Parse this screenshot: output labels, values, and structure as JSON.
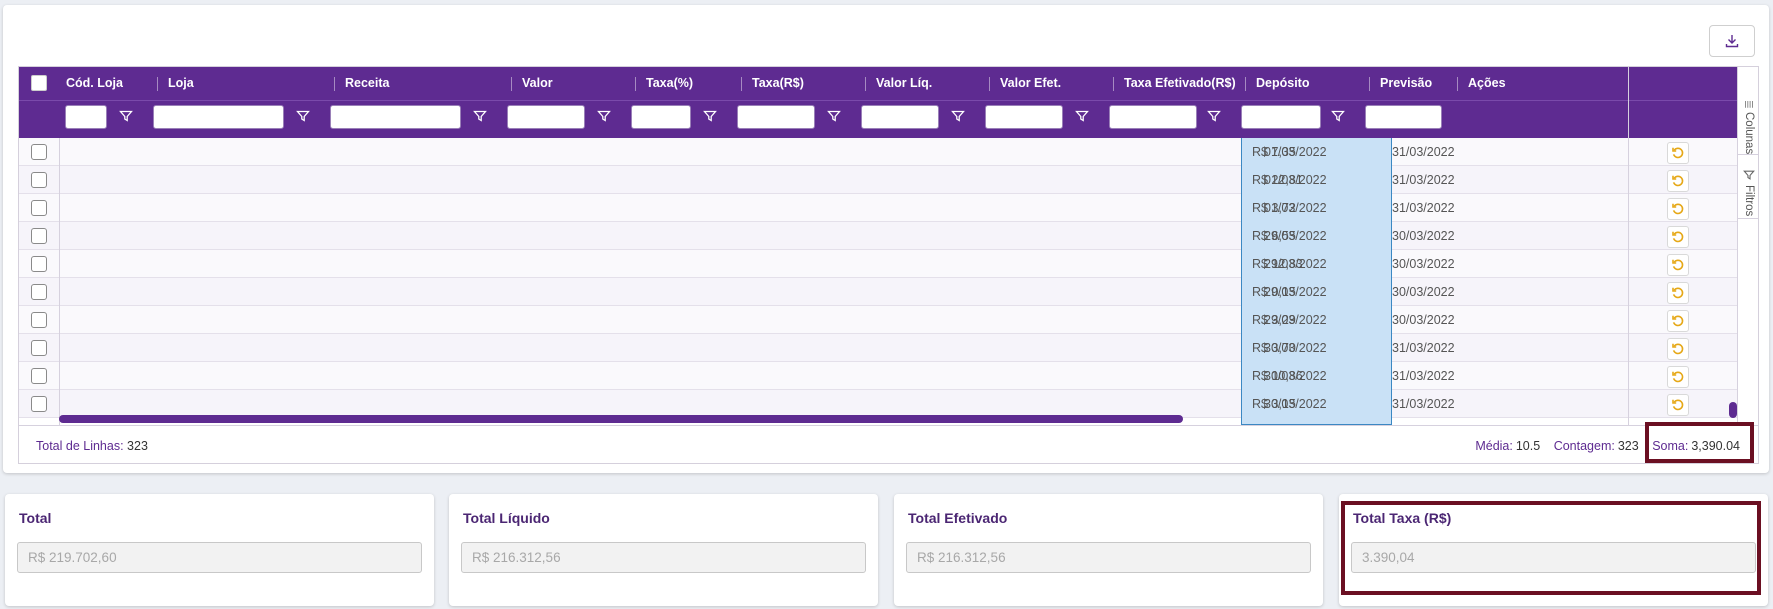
{
  "toolbar": {
    "export_icon": "download-icon"
  },
  "grid": {
    "columns": [
      {
        "key": "cod_loja",
        "label": "Cód. Loja"
      },
      {
        "key": "loja",
        "label": "Loja"
      },
      {
        "key": "receita",
        "label": "Receita"
      },
      {
        "key": "valor",
        "label": "Valor"
      },
      {
        "key": "taxa_pct",
        "label": "Taxa(%)"
      },
      {
        "key": "taxa_rs",
        "label": "Taxa(R$)"
      },
      {
        "key": "valor_liq",
        "label": "Valor Líq."
      },
      {
        "key": "valor_efet",
        "label": "Valor Efet."
      },
      {
        "key": "taxa_efetivado",
        "label": "Taxa Efetivado(R$)"
      },
      {
        "key": "deposito",
        "label": "Depósito"
      },
      {
        "key": "previsao",
        "label": "Previsão"
      },
      {
        "key": "acoes",
        "label": "Ações"
      }
    ],
    "rows": [
      {
        "taxa_efetivado": "R$ 7,35",
        "deposito": "01/03/2022",
        "previsao": "31/03/2022"
      },
      {
        "taxa_efetivado": "R$ 22,81",
        "deposito": "01/03/2022",
        "previsao": "31/03/2022"
      },
      {
        "taxa_efetivado": "R$ 3,72",
        "deposito": "01/03/2022",
        "previsao": "31/03/2022"
      },
      {
        "taxa_efetivado": "R$ 6,55",
        "deposito": "29/03/2022",
        "previsao": "30/03/2022"
      },
      {
        "taxa_efetivado": "R$ 12,83",
        "deposito": "29/03/2022",
        "previsao": "30/03/2022"
      },
      {
        "taxa_efetivado": "R$ 0,15",
        "deposito": "29/03/2022",
        "previsao": "30/03/2022"
      },
      {
        "taxa_efetivado": "R$ 3,29",
        "deposito": "29/03/2022",
        "previsao": "30/03/2022"
      },
      {
        "taxa_efetivado": "R$ 3,70",
        "deposito": "30/03/2022",
        "previsao": "31/03/2022"
      },
      {
        "taxa_efetivado": "R$ 10,86",
        "deposito": "30/03/2022",
        "previsao": "31/03/2022"
      },
      {
        "taxa_efetivado": "R$ 3,15",
        "deposito": "30/03/2022",
        "previsao": "31/03/2022"
      }
    ],
    "side_panel": {
      "columns_label": "Colunas",
      "filters_label": "Filtros"
    },
    "status": {
      "total_lines_label": "Total de Linhas:",
      "total_lines_value": "323",
      "media_label": "Média:",
      "media_value": "10.5",
      "contagem_label": "Contagem:",
      "contagem_value": "323",
      "soma_label": "Soma:",
      "soma_value": "3,390.04"
    }
  },
  "totals": [
    {
      "title": "Total",
      "value": "R$ 219.702,60"
    },
    {
      "title": "Total Líquido",
      "value": "R$ 216.312,56"
    },
    {
      "title": "Total Efetivado",
      "value": "R$ 216.312,56"
    },
    {
      "title": "Total Taxa (R$)",
      "value": "3.390,04"
    }
  ],
  "colors": {
    "header_bg": "#5e2b91",
    "selected_column_bg": "#c9e1f6",
    "highlight_border": "#6b0f22",
    "action_icon": "#e6a817"
  }
}
